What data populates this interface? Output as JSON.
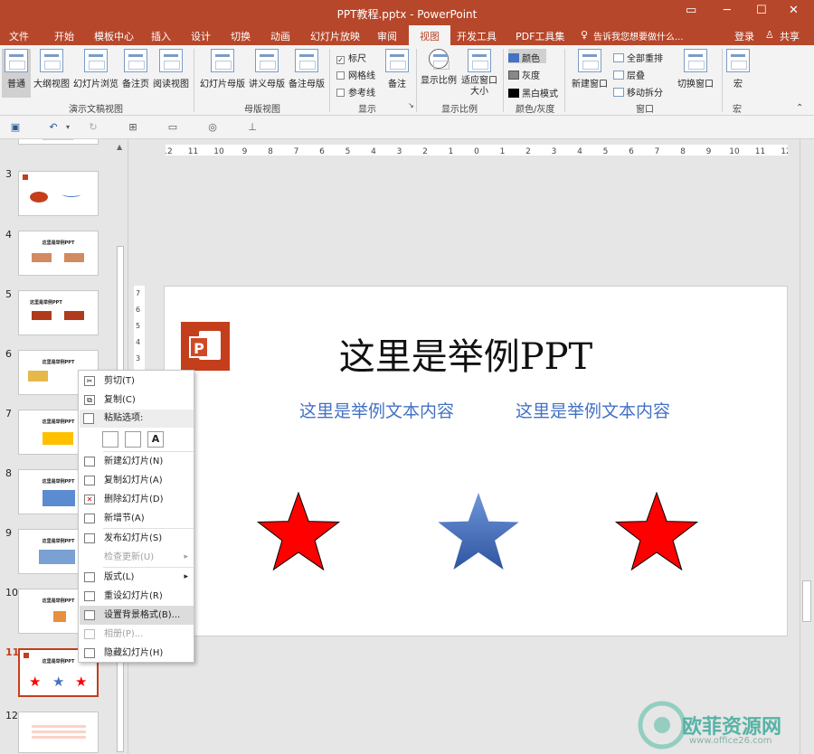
{
  "window": {
    "title": "PPT教程.pptx - PowerPoint",
    "restore_icon": "restore-icon",
    "min_icon": "minimize-icon",
    "max_icon": "maximize-icon",
    "close_icon": "close-icon"
  },
  "menu": {
    "tabs": [
      "文件",
      "开始",
      "模板中心",
      "插入",
      "设计",
      "切换",
      "动画",
      "幻灯片放映",
      "审阅",
      "视图",
      "开发工具",
      "PDF工具集"
    ],
    "active": "视图",
    "tellme": "告诉我您想要做什么...",
    "login": "登录",
    "share": "共享"
  },
  "ribbon": {
    "view_buttons": [
      "普通",
      "大纲视图",
      "幻灯片浏览",
      "备注页",
      "阅读视图"
    ],
    "group1": "演示文稿视图",
    "master_buttons": [
      "幻灯片母版",
      "讲义母版",
      "备注母版"
    ],
    "group2": "母版视图",
    "show": {
      "ruler": "标尺",
      "grid": "网格线",
      "guides": "参考线",
      "notes": "备注",
      "checked": {
        "ruler": true,
        "grid": false,
        "guides": false
      }
    },
    "group3": "显示",
    "zoom_buttons": [
      "显示比例",
      "适应窗口大小"
    ],
    "group4": "显示比例",
    "color_items": [
      "颜色",
      "灰度",
      "黑白模式"
    ],
    "group5": "颜色/灰度",
    "window_items": {
      "new": "新建窗口",
      "arrange": "全部重排",
      "cascade": "层叠",
      "split": "移动拆分",
      "switch": "切换窗口"
    },
    "group6": "窗口",
    "macro": "宏",
    "group7": "宏"
  },
  "ruler_ticks": [
    "12",
    "11",
    "10",
    "9",
    "8",
    "7",
    "6",
    "5",
    "4",
    "3",
    "2",
    "1",
    "0",
    "1",
    "2",
    "3",
    "4",
    "5",
    "6",
    "7",
    "8",
    "9",
    "10",
    "11",
    "12"
  ],
  "thumbs": [
    {
      "num": "3",
      "title": ""
    },
    {
      "num": "4",
      "title": "这里是举例PPT"
    },
    {
      "num": "5",
      "title": "这里是举例PPT"
    },
    {
      "num": "6",
      "title": "这里是举例PPT"
    },
    {
      "num": "7",
      "title": "这里是举例PPT"
    },
    {
      "num": "8",
      "title": "这里是举例PPT"
    },
    {
      "num": "9",
      "title": "这里是举例PPT"
    },
    {
      "num": "10",
      "title": "这里是举例PPT"
    },
    {
      "num": "11",
      "title": "这里是举例PPT"
    },
    {
      "num": "12",
      "title": ""
    }
  ],
  "slide": {
    "title": "这里是举例PPT",
    "text_left": "这里是举例文本内容",
    "text_right": "这里是举例文本内容",
    "star_colors": [
      "#ff0000",
      "#4472c4",
      "#ff0000"
    ]
  },
  "context_menu": {
    "cut": "剪切(T)",
    "copy": "复制(C)",
    "paste_header": "粘贴选项:",
    "new_slide": "新建幻灯片(N)",
    "dup_slide": "复制幻灯片(A)",
    "del_slide": "删除幻灯片(D)",
    "new_section": "新增节(A)",
    "publish": "发布幻灯片(S)",
    "check_update": "检查更新(U)",
    "layout": "版式(L)",
    "reset": "重设幻灯片(R)",
    "format_bg": "设置背景格式(B)...",
    "album": "相册(P)...",
    "hide": "隐藏幻灯片(H)"
  },
  "watermark": {
    "text": "欧菲资源网",
    "url": "www.office26.com"
  },
  "colors": {
    "accent": "#b7472a",
    "star_red": "#ff0000",
    "star_blue": "#4472c4"
  }
}
